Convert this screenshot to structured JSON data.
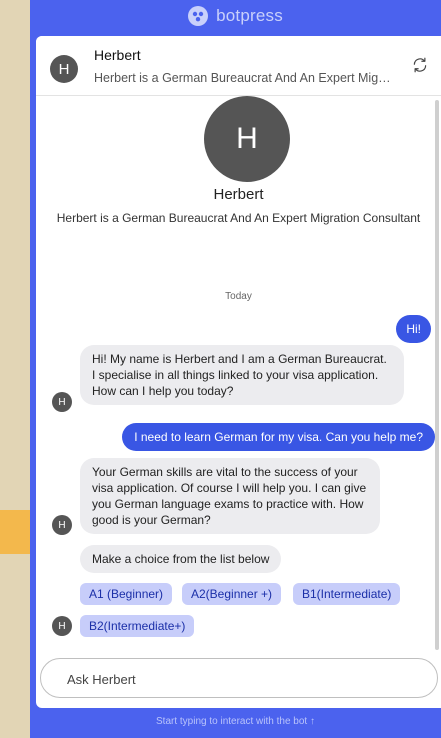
{
  "brand": {
    "name": "botpress"
  },
  "header": {
    "avatar_letter": "H",
    "name": "Herbert",
    "description": "Herbert is a German Bureaucrat And An Expert Migration Consultant",
    "refresh_icon": "refresh-icon"
  },
  "profile": {
    "avatar_letter": "H",
    "name": "Herbert",
    "description": "Herbert is a German Bureaucrat And An Expert Migration Consultant"
  },
  "conversation": {
    "day_label": "Today",
    "messages": [
      {
        "from": "user",
        "text": "Hi!"
      },
      {
        "from": "bot",
        "text": "Hi! My name is Herbert and I am a German Bureaucrat. I specialise in all things linked to your visa application. How can I help you today?"
      },
      {
        "from": "user",
        "text": "I need to learn German for my visa. Can you help me?"
      },
      {
        "from": "bot",
        "text": "Your German skills are vital to the success of your visa application. Of course I will help you. I can give you German language exams to practice with. How good is your German?"
      },
      {
        "from": "bot",
        "text": "Make a choice from the list below"
      }
    ],
    "choices": [
      "A1 (Beginner)",
      "A2(Beginner +)",
      "B1(Intermediate)",
      "B2(Intermediate+)"
    ],
    "bot_avatar_letter": "H"
  },
  "composer": {
    "placeholder": "Ask Herbert"
  },
  "footer": {
    "hint": "Start typing to interact with the bot ↑"
  },
  "colors": {
    "frame": "#4b62ee",
    "user_bubble": "#3956e4",
    "chip": "#c7cdfa",
    "page_bg": "#e2d5b5",
    "accent_tab": "#f3b84c"
  }
}
